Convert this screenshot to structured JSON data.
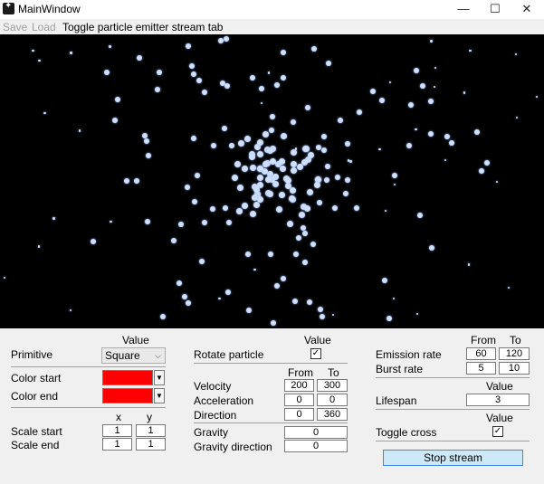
{
  "window": {
    "title": "MainWindow",
    "minimize_icon": "minimize-icon",
    "maximize_icon": "maximize-icon",
    "close_icon": "close-icon"
  },
  "menu": {
    "save": "Save",
    "load": "Load",
    "toggle_tab": "Toggle particle emitter stream tab"
  },
  "panel": {
    "col1": {
      "value_header": "Value",
      "primitive_label": "Primitive",
      "primitive_value": "Square",
      "color_start_label": "Color start",
      "color_start_value": "#ff0000",
      "color_end_label": "Color end",
      "color_end_value": "#ff0000",
      "x_header": "x",
      "y_header": "y",
      "scale_start_label": "Scale start",
      "scale_start_x": "1",
      "scale_start_y": "1",
      "scale_end_label": "Scale end",
      "scale_end_x": "1",
      "scale_end_y": "1"
    },
    "col2": {
      "value_header": "Value",
      "rotate_label": "Rotate particle",
      "rotate_checked": "✓",
      "from_header": "From",
      "to_header": "To",
      "velocity_label": "Velocity",
      "velocity_from": "200",
      "velocity_to": "300",
      "acceleration_label": "Acceleration",
      "acceleration_from": "0",
      "acceleration_to": "0",
      "direction_label": "Direction",
      "direction_from": "0",
      "direction_to": "360",
      "gravity_label": "Gravity",
      "gravity_value": "0",
      "gravity_direction_label": "Gravity direction",
      "gravity_direction_value": "0"
    },
    "col3": {
      "from_header": "From",
      "to_header": "To",
      "emission_label": "Emission rate",
      "emission_from": "60",
      "emission_to": "120",
      "burst_label": "Burst rate",
      "burst_from": "5",
      "burst_to": "10",
      "value_header": "Value",
      "lifespan_label": "Lifespan",
      "lifespan_value": "3",
      "value_header2": "Value",
      "toggle_cross_label": "Toggle cross",
      "toggle_cross_checked": "✓",
      "stop_stream_label": "Stop stream"
    }
  }
}
